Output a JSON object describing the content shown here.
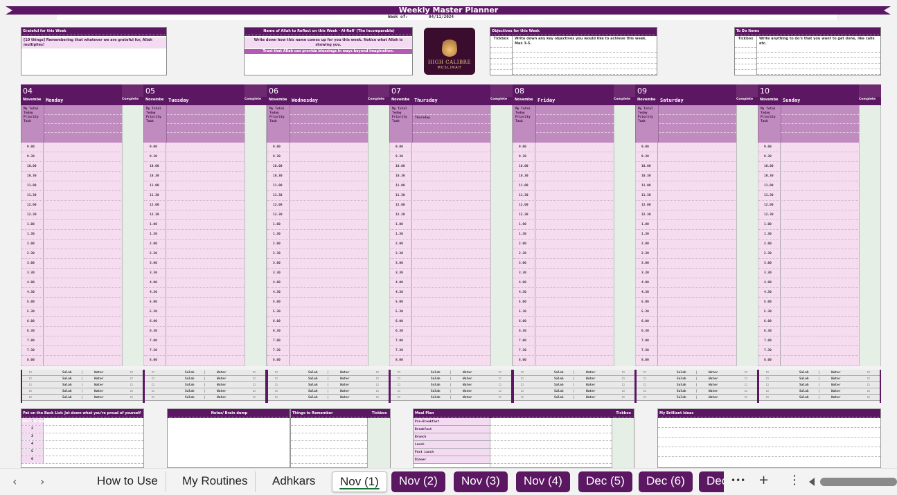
{
  "title": "Weekly Master Planner",
  "week_of_label": "Week of:",
  "week_of_value": "04/11/2024",
  "grateful": {
    "header": "Grateful for this Week",
    "text": "[10 things] Remembering that whatever we are grateful for, Allah multiplies!"
  },
  "allah_name": {
    "header": "Name of Allah to Reflect on this Week - Al-Rafi' (The Incomparable)",
    "text1": "Write down how this name comes up for you this week. Notice what Allah is showing you.",
    "text2": "Trust that Allah can provide blessings in ways beyond imagination."
  },
  "logo": {
    "name": "HIGH CALIBRE",
    "sub": "MUSLIMAH"
  },
  "objectives": {
    "header": "Objectives for this Week",
    "col1": "Tickbox",
    "col2": "Write down any key objectives you would like to achieve this week. Max 3-5."
  },
  "todo": {
    "header": "To Do Items",
    "col1": "Tickbox",
    "col2": "Write anything to do's that you want to get done, like calls etc."
  },
  "priority_label": "My Total Today Priority Task",
  "complete_label": "Complete",
  "days": [
    {
      "num": "04",
      "month": "Novembe",
      "name": "Monday",
      "extra": ""
    },
    {
      "num": "05",
      "month": "Novembe",
      "name": "Tuesday",
      "extra": ""
    },
    {
      "num": "06",
      "month": "Novembe",
      "name": "Wednesday",
      "extra": ""
    },
    {
      "num": "07",
      "month": "Novembe",
      "name": "Thursday",
      "extra": "Thursday"
    },
    {
      "num": "08",
      "month": "Novembe",
      "name": "Friday",
      "extra": ""
    },
    {
      "num": "09",
      "month": "Novembe",
      "name": "Saturday",
      "extra": ""
    },
    {
      "num": "10",
      "month": "Novembe",
      "name": "Sunday",
      "extra": ""
    }
  ],
  "times": [
    "9.00",
    "9.30",
    "10.00",
    "10.30",
    "11.00",
    "11.30",
    "12.00",
    "12.30",
    "1.00",
    "1.30",
    "2.00",
    "2.30",
    "3.00",
    "3.30",
    "4.00",
    "4.30",
    "5.00",
    "5.30",
    "6.00",
    "6.30",
    "7.00",
    "7.30",
    "8.00"
  ],
  "salah_label": "Salah",
  "water_label": "Water",
  "checkbox_glyph": "☐",
  "bottom": {
    "proud": "Pat on the Back List: Jot down what you're proud of yourself for this week",
    "proud_rows": [
      "1",
      "2",
      "3",
      "4",
      "5",
      "6"
    ],
    "notes": "Notes/ Brain dump",
    "remember": "Things to Remember",
    "tickbox": "Tickbox",
    "meal": "Meal Plan",
    "meals": [
      "Pre-Breakfast",
      "Breakfast",
      "Brunch",
      "Lunch",
      "Post Lunch",
      "Dinner"
    ],
    "ideas": "My Brilliant Ideas"
  },
  "tabs": {
    "prev": "‹",
    "next": "›",
    "items": [
      "How to Use",
      "My Routines",
      "Adhkars",
      "Nov (1)",
      "Nov (2)",
      "Nov (3)",
      "Nov (4)",
      "Dec (5)",
      "Dec (6)",
      "Dec"
    ],
    "more": "•••",
    "add": "+",
    "menu": "⋮"
  },
  "colors": {
    "accent": "#5c1763",
    "pink": "#f6dcef",
    "green": "#e6efe6",
    "active_underline": "#137333"
  }
}
